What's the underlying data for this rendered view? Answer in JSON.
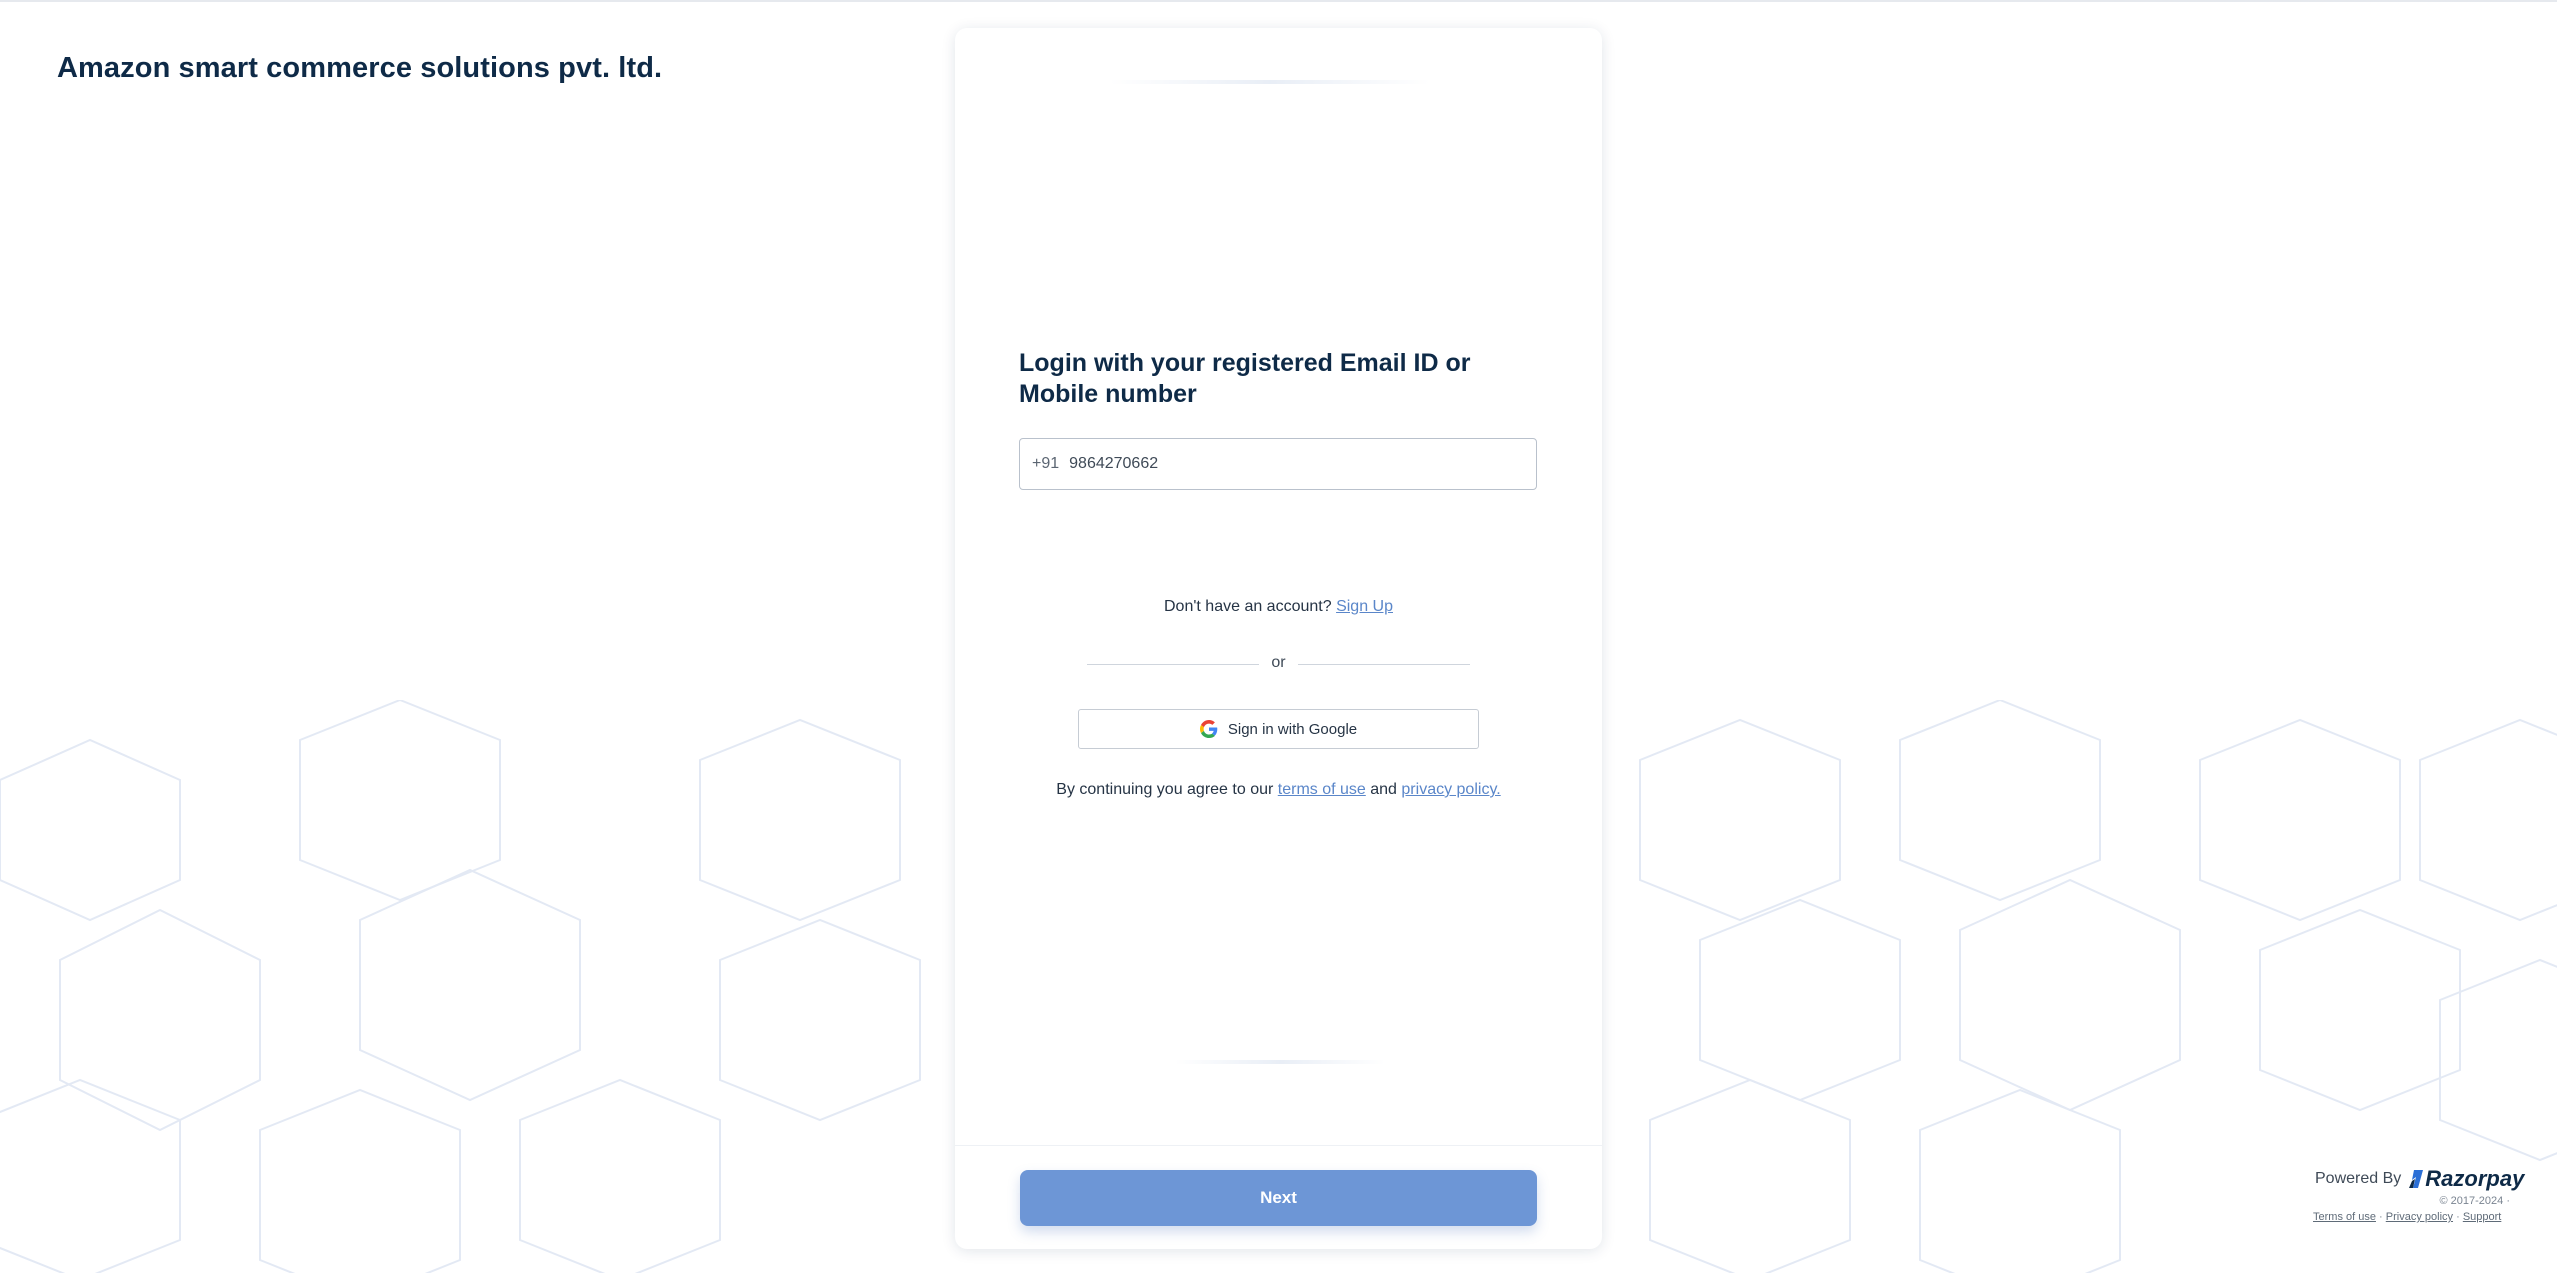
{
  "merchant": {
    "name": "Amazon smart commerce solutions pvt. ltd."
  },
  "login": {
    "heading": "Login with your registered Email ID or Mobile number",
    "country_code": "+91",
    "phone_value": "9864270662"
  },
  "signup": {
    "prompt": "Don't have an account?",
    "link_label": "Sign Up"
  },
  "divider": {
    "label": "or"
  },
  "google": {
    "button_label": "Sign in with Google",
    "icon": "google-icon"
  },
  "consent": {
    "prefix": "By continuing you agree to our",
    "terms_label": "terms of use",
    "joiner": "and",
    "privacy_label": "privacy policy."
  },
  "actions": {
    "next_label": "Next"
  },
  "footer": {
    "powered_by": "Powered By",
    "brand": "Razorpay",
    "copyright": "© 2017-2024 ·",
    "terms_label": "Terms of use",
    "separator": "·",
    "privacy_label": "Privacy policy",
    "support_label": "Support"
  },
  "colors": {
    "accent": "#6d96d6",
    "link": "#5a86c9",
    "heading": "#0e2a47"
  }
}
